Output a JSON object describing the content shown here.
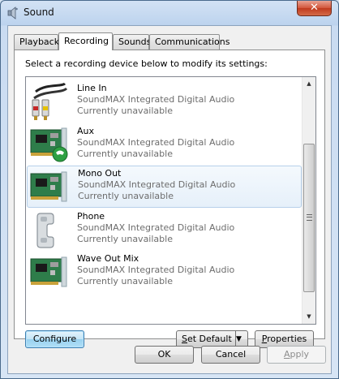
{
  "window": {
    "title": "Sound",
    "close_label": "✕"
  },
  "tabs": [
    {
      "label": "Playback"
    },
    {
      "label": "Recording"
    },
    {
      "label": "Sounds"
    },
    {
      "label": "Communications"
    }
  ],
  "active_tab": "Recording",
  "instruction": "Select a recording device below to modify its settings:",
  "devices": [
    {
      "name": "Line In",
      "description": "SoundMAX Integrated Digital Audio",
      "status": "Currently unavailable",
      "icon": "rca-cable-icon"
    },
    {
      "name": "Aux",
      "description": "SoundMAX Integrated Digital Audio",
      "status": "Currently unavailable",
      "icon": "sound-card-phone-icon"
    },
    {
      "name": "Mono Out",
      "description": "SoundMAX Integrated Digital Audio",
      "status": "Currently unavailable",
      "icon": "sound-card-icon",
      "selected": true
    },
    {
      "name": "Phone",
      "description": "SoundMAX Integrated Digital Audio",
      "status": "Currently unavailable",
      "icon": "phone-handset-icon"
    },
    {
      "name": "Wave Out Mix",
      "description": "SoundMAX Integrated Digital Audio",
      "status": "Currently unavailable",
      "icon": "sound-card-icon"
    }
  ],
  "buttons": {
    "configure": "Configure",
    "set_default_prefix": "S",
    "set_default_rest": "et Default",
    "properties_prefix": "P",
    "properties_rest": "roperties",
    "ok": "OK",
    "cancel": "Cancel",
    "apply_prefix": "A",
    "apply_rest": "pply"
  },
  "colors": {
    "selection": "#e6f0fa",
    "secondary_text": "#6d6d6d",
    "default_button": "#c4e5f6"
  }
}
